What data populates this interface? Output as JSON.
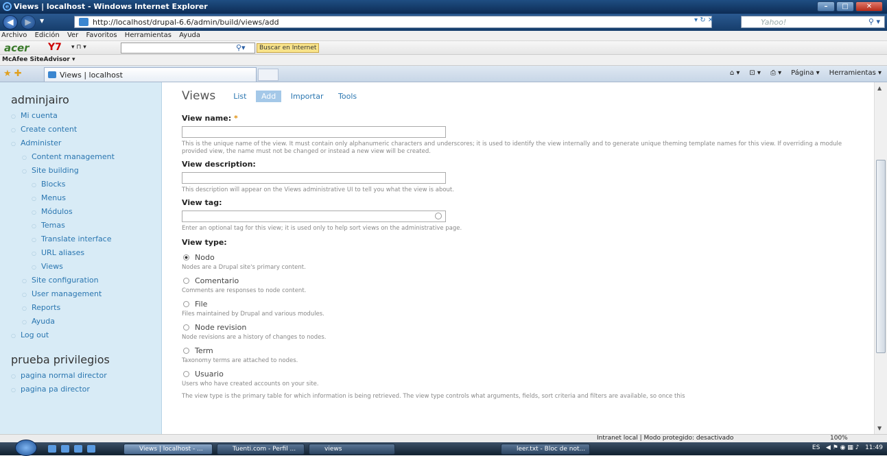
{
  "window": {
    "title": "Views | localhost - Windows Internet Explorer"
  },
  "address": {
    "url": "http://localhost/drupal-6.6/admin/build/views/add",
    "search_placeholder": "Yahoo!"
  },
  "menubar": [
    "Archivo",
    "Edición",
    "Ver",
    "Favoritos",
    "Herramientas",
    "Ayuda"
  ],
  "acerbar": {
    "brand": "acer",
    "y7": "Y7",
    "buscar": "Buscar en Internet"
  },
  "mcafee": "McAfee SiteAdvisor",
  "tab": {
    "label": "Views | localhost"
  },
  "tools": {
    "pagina": "Página",
    "herramientas": "Herramientas"
  },
  "sidebar": {
    "user_block_title": "adminjairo",
    "items": [
      {
        "label": "Mi cuenta",
        "level": 0
      },
      {
        "label": "Create content",
        "level": 0
      },
      {
        "label": "Administer",
        "level": 0
      },
      {
        "label": "Content management",
        "level": 1
      },
      {
        "label": "Site building",
        "level": 1
      },
      {
        "label": "Blocks",
        "level": 2
      },
      {
        "label": "Menus",
        "level": 2
      },
      {
        "label": "Módulos",
        "level": 2
      },
      {
        "label": "Temas",
        "level": 2
      },
      {
        "label": "Translate interface",
        "level": 2
      },
      {
        "label": "URL aliases",
        "level": 2
      },
      {
        "label": "Views",
        "level": 2
      },
      {
        "label": "Site configuration",
        "level": 1
      },
      {
        "label": "User management",
        "level": 1
      },
      {
        "label": "Reports",
        "level": 1
      },
      {
        "label": "Ayuda",
        "level": 1
      },
      {
        "label": "Log out",
        "level": 0
      }
    ],
    "block2_title": "prueba privilegios",
    "block2_items": [
      "pagina normal director",
      "pagina pa director"
    ]
  },
  "content": {
    "title": "Views",
    "tabs": [
      "List",
      "Add",
      "Importar",
      "Tools"
    ],
    "view_name_label": "View name:",
    "required_mark": "*",
    "view_name_desc": "This is the unique name of the view. It must contain only alphanumeric characters and underscores; it is used to identify the view internally and to generate unique theming template names for this view. If overriding a module provided view, the name must not be changed or instead a new view will be created.",
    "view_desc_label": "View description:",
    "view_desc_desc": "This description will appear on the Views administrative UI to tell you what the view is about.",
    "view_tag_label": "View tag:",
    "view_tag_desc": "Enter an optional tag for this view; it is used only to help sort views on the administrative page.",
    "view_type_label": "View type:",
    "types": [
      {
        "label": "Nodo",
        "desc": "Nodes are a Drupal site's primary content.",
        "checked": true
      },
      {
        "label": "Comentario",
        "desc": "Comments are responses to node content.",
        "checked": false
      },
      {
        "label": "File",
        "desc": "Files maintained by Drupal and various modules.",
        "checked": false
      },
      {
        "label": "Node revision",
        "desc": "Node revisions are a history of changes to nodes.",
        "checked": false
      },
      {
        "label": "Term",
        "desc": "Taxonomy terms are attached to nodes.",
        "checked": false
      },
      {
        "label": "Usuario",
        "desc": "Users who have created accounts on your site.",
        "checked": false
      }
    ],
    "view_type_desc": "The view type is the primary table for which information is being retrieved. The view type controls what arguments, fields, sort criteria and filters are available, so once this"
  },
  "status": {
    "zone": "Intranet local | Modo protegido: desactivado",
    "zoom": "100%"
  },
  "taskbar": {
    "buttons": [
      "Views | localhost - ...",
      "Tuenti.com - Perfil ...",
      "views",
      "leer.txt - Bloc de not..."
    ],
    "lang": "ES",
    "clock": "11:49"
  }
}
